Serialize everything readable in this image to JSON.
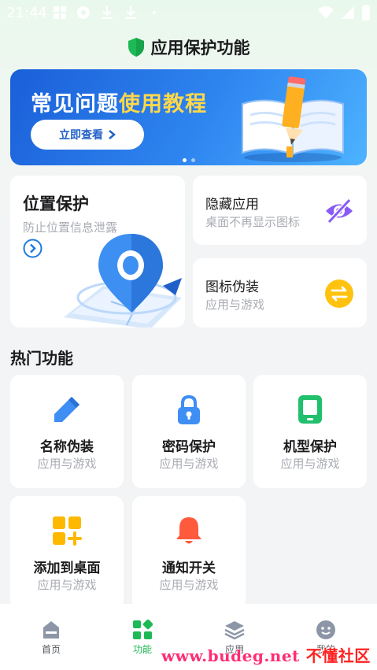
{
  "status_bar": {
    "time": "21:44"
  },
  "header": {
    "title": "应用保护功能"
  },
  "banner": {
    "title_part1": "常见问题",
    "title_part2": "使用教程",
    "button_label": "立即查看"
  },
  "features": {
    "location": {
      "title": "位置保护",
      "subtitle": "防止位置信息泄露"
    },
    "hide_app": {
      "title": "隐藏应用",
      "subtitle": "桌面不再显示图标"
    },
    "icon_disguise": {
      "title": "图标伪装",
      "subtitle": "应用与游戏"
    }
  },
  "hot_section": {
    "title": "热门功能",
    "items": [
      {
        "name": "名称伪装",
        "subtitle": "应用与游戏",
        "icon": "pencil-icon"
      },
      {
        "name": "密码保护",
        "subtitle": "应用与游戏",
        "icon": "lock-icon"
      },
      {
        "name": "机型保护",
        "subtitle": "应用与游戏",
        "icon": "tablet-icon"
      },
      {
        "name": "添加到桌面",
        "subtitle": "应用与游戏",
        "icon": "add-grid-icon"
      },
      {
        "name": "通知开关",
        "subtitle": "应用与游戏",
        "icon": "bell-icon"
      }
    ]
  },
  "bottom_nav": {
    "items": [
      {
        "label": "首页",
        "icon": "home-icon"
      },
      {
        "label": "功能",
        "icon": "apps-icon",
        "active": true
      },
      {
        "label": "应用",
        "icon": "layers-icon"
      },
      {
        "label": "我的",
        "icon": "smiley-icon"
      }
    ]
  },
  "watermark": {
    "url": "www.budeg.net",
    "text": "不懂社区"
  },
  "colors": {
    "accent": "#1db954",
    "banner_blue": "#2f86f0",
    "highlight_yellow": "#ffd84a"
  }
}
